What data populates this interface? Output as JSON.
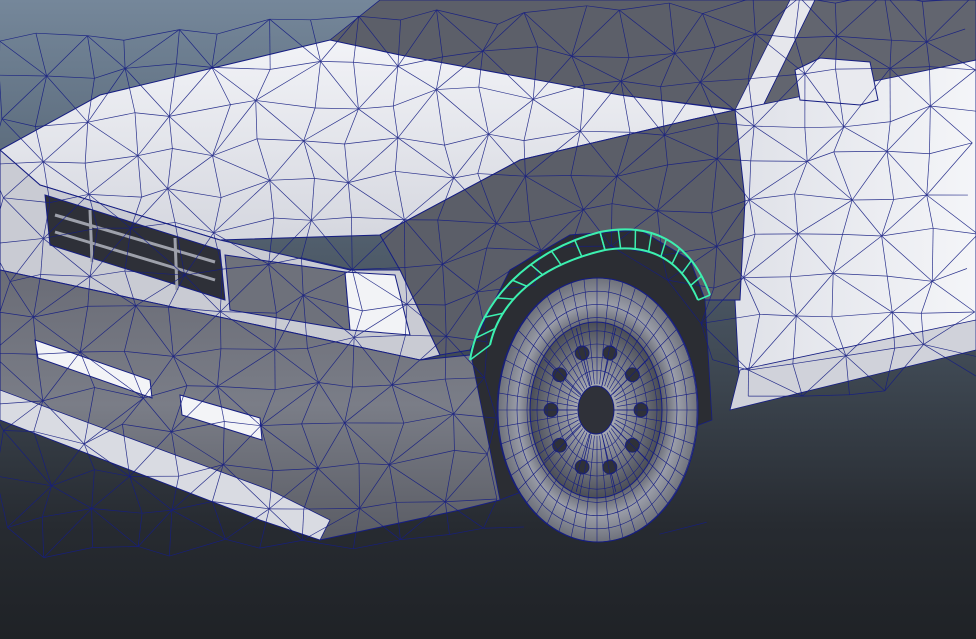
{
  "viewport": {
    "kind": "3d-modeling-viewport",
    "display_mode": "wireframe-on-shaded",
    "model": "car-front-three-quarter",
    "selection": "wheel-arch-fender-flare",
    "colors": {
      "background_top": "#75879a",
      "background_bottom": "#1f2226",
      "wire": "#161e82",
      "selection": "#3cf0b0",
      "body_light": "#e8e9ef",
      "body_mid": "#9c9fa9",
      "body_dark": "#4e5058",
      "tire": "#8c8f99",
      "rim": "#6a6d78"
    }
  }
}
